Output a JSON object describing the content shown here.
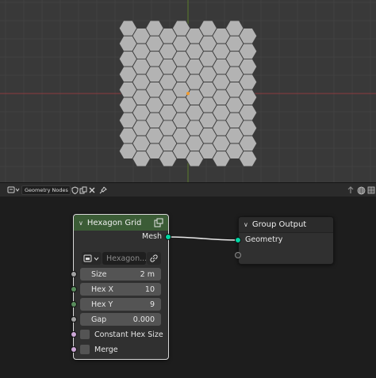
{
  "node_editor": {
    "tree_name": "Geometry Nodes"
  },
  "hexagon_node": {
    "title": "Hexagon Grid",
    "output_label": "Mesh",
    "material_placeholder": "Hexagon...",
    "inputs": [
      {
        "label": "Size",
        "value": "2 m"
      },
      {
        "label": "Hex X",
        "value": "10"
      },
      {
        "label": "Hex Y",
        "value": "9"
      },
      {
        "label": "Gap",
        "value": "0.000"
      }
    ],
    "checkboxes": [
      {
        "label": "Constant Hex Size"
      },
      {
        "label": "Merge"
      }
    ]
  },
  "group_output_node": {
    "title": "Group Output",
    "input_label": "Geometry"
  },
  "colors": {
    "geometry_socket": "#00d6a3",
    "int_socket": "#598c5c",
    "float_socket": "#a1a1a1",
    "bool_socket": "#cca6d6",
    "node_header_green": "#3b5c36",
    "hexagon_fill": "#b3b3b3",
    "viewport_bg": "#393939"
  }
}
